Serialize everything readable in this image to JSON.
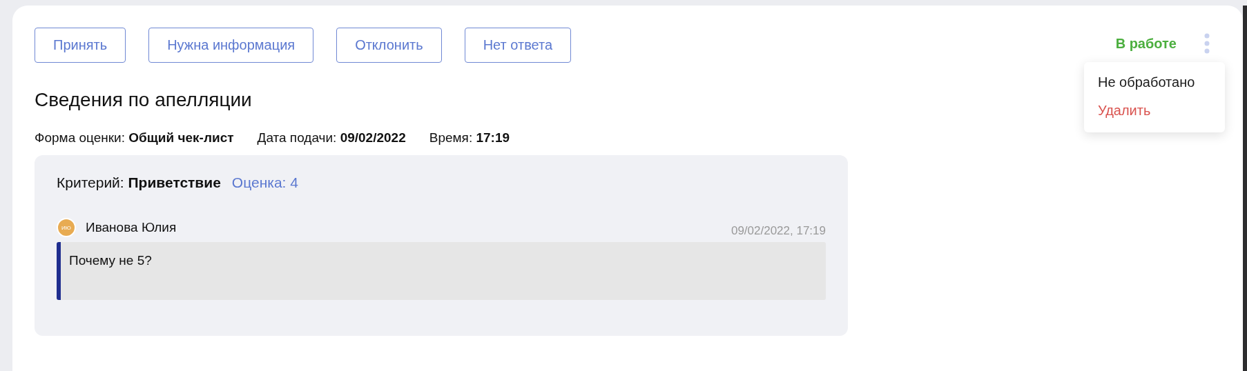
{
  "actions": [
    {
      "label": "Принять"
    },
    {
      "label": "Нужна информация"
    },
    {
      "label": "Отклонить"
    },
    {
      "label": "Нет ответа"
    }
  ],
  "status": {
    "label": "В работе",
    "color": "#4caf3f"
  },
  "status_menu": {
    "items": [
      {
        "label": "Не обработано",
        "kind": "normal"
      },
      {
        "label": "Удалить",
        "kind": "danger"
      }
    ]
  },
  "heading": "Сведения по апелляции",
  "meta": [
    {
      "label": "Форма оценки:",
      "value": "Общий чек-лист"
    },
    {
      "label": "Дата подачи:",
      "value": "09/02/2022"
    },
    {
      "label": "Время:",
      "value": "17:19"
    }
  ],
  "criterion": {
    "label": "Критерий:",
    "name": "Приветствие",
    "score": "Оценка: 4"
  },
  "comment": {
    "initials": "ИЮ",
    "author": "Иванова Юлия",
    "time": "09/02/2022, 17:19",
    "text": "Почему не 5?"
  }
}
